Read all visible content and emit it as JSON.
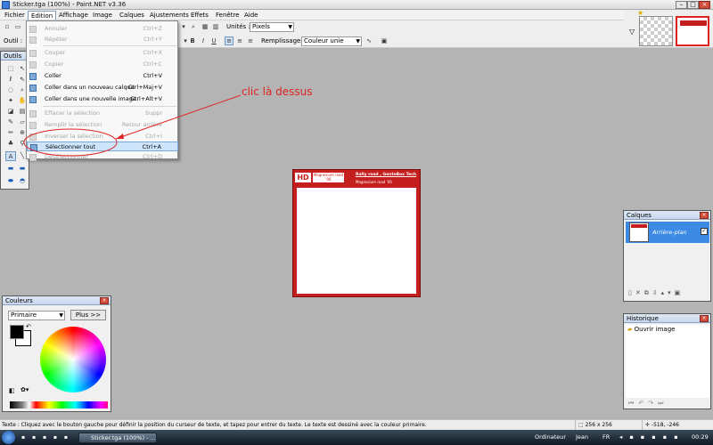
{
  "window": {
    "title": "Sticker.tga (100%) - Paint.NET v3.36"
  },
  "menubar": {
    "items": [
      {
        "id": "fichier",
        "label": "Fichier"
      },
      {
        "id": "edition",
        "label": "Edition"
      },
      {
        "id": "affichage",
        "label": "Affichage"
      },
      {
        "id": "image",
        "label": "Image"
      },
      {
        "id": "calques",
        "label": "Calques"
      },
      {
        "id": "ajustements",
        "label": "Ajustements"
      },
      {
        "id": "effets",
        "label": "Effets"
      },
      {
        "id": "fenetre",
        "label": "Fenêtre"
      },
      {
        "id": "aide",
        "label": "Aide"
      }
    ]
  },
  "toolbar": {
    "units_label": "Unités :",
    "units_value": "Pixels",
    "tool_label": "Outil :",
    "fill_label": "Remplissage :",
    "fill_value": "Couleur unie",
    "bold": "B",
    "italic": "I",
    "underline": "U"
  },
  "edit_menu": [
    {
      "label": "Annuler",
      "shortcut": "Ctrl+Z",
      "disabled": true,
      "icon": "undo-icon"
    },
    {
      "label": "Répéter",
      "shortcut": "Ctrl+Y",
      "disabled": true,
      "icon": "redo-icon"
    },
    {
      "label": "Couper",
      "shortcut": "Ctrl+X",
      "disabled": true,
      "icon": "cut-icon"
    },
    {
      "label": "Copier",
      "shortcut": "Ctrl+C",
      "disabled": true,
      "icon": "copy-icon"
    },
    {
      "label": "Coller",
      "shortcut": "Ctrl+V",
      "disabled": false,
      "icon": "paste-icon"
    },
    {
      "label": "Coller dans un nouveau calque",
      "shortcut": "Ctrl+Maj+V",
      "disabled": false,
      "icon": "paste-layer-icon"
    },
    {
      "label": "Coller dans une nouvelle image",
      "shortcut": "Ctrl+Alt+V",
      "disabled": false,
      "icon": "paste-image-icon"
    },
    {
      "label": "Effacer la sélection",
      "shortcut": "Suppr",
      "disabled": true,
      "icon": "erase-selection-icon"
    },
    {
      "label": "Remplir la sélection",
      "shortcut": "Retour arrière",
      "disabled": true,
      "icon": "fill-selection-icon"
    },
    {
      "label": "Inverser la sélection",
      "shortcut": "Ctrl+I",
      "disabled": true,
      "icon": "invert-selection-icon"
    },
    {
      "label": "Sélectionner tout",
      "shortcut": "Ctrl+A",
      "disabled": false,
      "highlighted": true,
      "icon": "select-all-icon"
    },
    {
      "label": "Désélectionner",
      "shortcut": "Ctrl+D",
      "disabled": true,
      "icon": "deselect-icon"
    }
  ],
  "annotation": {
    "text": "clic là dessus"
  },
  "tools_panel": {
    "title": "Outils"
  },
  "colors_panel": {
    "title": "Couleurs",
    "mode": "Primaire",
    "more_button": "Plus >>"
  },
  "layers_panel": {
    "title": "Calques",
    "layer_name": "Arrière-plan"
  },
  "history_panel": {
    "title": "Historique",
    "entry": "Ouvrir image"
  },
  "canvas": {
    "logo_text": "HD",
    "badge_text": "Magnesium road '06",
    "brand_line1": "Rally road , GenteBox Tech",
    "brand_line2": "Magnesium road '06"
  },
  "statusbar": {
    "hint": "Texte : Cliquez avec le bouton gauche pour définir la position du curseur de texte, et tapez pour entrer du texte. Le texte est dessiné avec la couleur primaire.",
    "size": "256 x 256",
    "coords": "-518, -246"
  },
  "taskbar": {
    "task1": "Sticker.tga (100%) - ...",
    "computer": "Ordinateur",
    "user": "Jean",
    "lang": "FR",
    "clock": "00:29"
  },
  "colors": {
    "accent_red": "#c41e1e",
    "annotation_red": "#e02424",
    "highlight": "#cde4fb"
  }
}
